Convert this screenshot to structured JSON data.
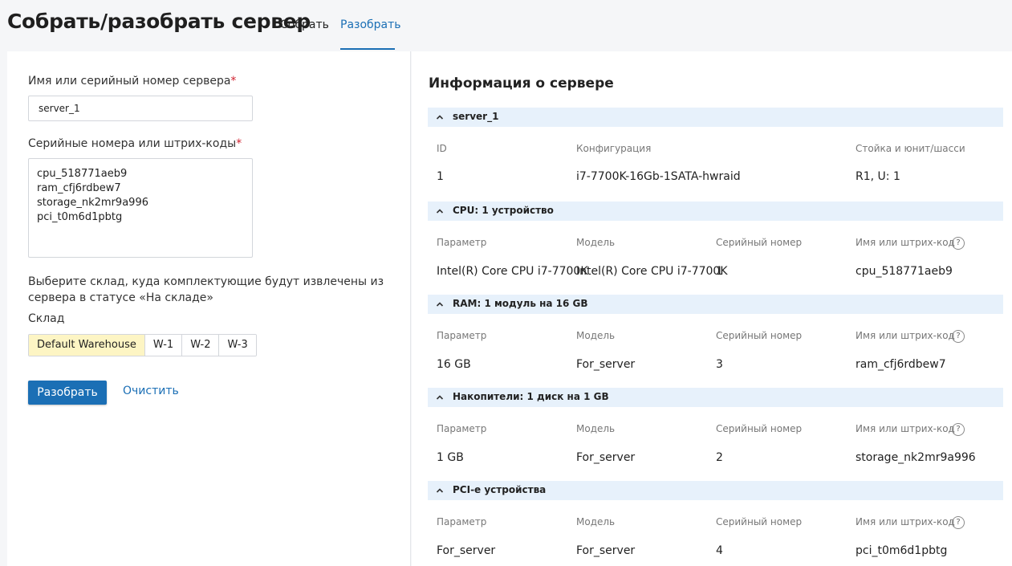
{
  "header": {
    "title": "Собрать/разобрать сервер",
    "tabs": [
      {
        "label": "Собрать"
      },
      {
        "label": "Разобрать"
      }
    ]
  },
  "form": {
    "server_label": "Имя или серийный номер сервера",
    "server_value": "server_1",
    "serials_label": "Серийные номера или штрих-коды",
    "serials_value": "cpu_518771aeb9\nram_cfj6rdbew7\nstorage_nk2mr9a996\npci_t0m6d1pbtg",
    "required_mark": "*",
    "warehouse_desc": "Выберите склад, куда комплектующие будут извлечены из сервера в статусе «На складе»",
    "warehouse_label": "Склад",
    "warehouses": [
      "Default Warehouse",
      "W-1",
      "W-2",
      "W-3"
    ],
    "submit_label": "Разобрать",
    "clear_label": "Очистить"
  },
  "info": {
    "title": "Информация о сервере",
    "help_glyph": "?",
    "server_section": {
      "title": "server_1",
      "headers": [
        "ID",
        "Конфигурация",
        "Стойка и юнит/шасси"
      ],
      "row": [
        "1",
        "i7-7700K-16Gb-1SATA-hwraid",
        "R1, U: 1"
      ]
    },
    "sections": [
      {
        "title": "CPU: 1 устройство",
        "headers": [
          "Параметр",
          "Модель",
          "Серийный номер",
          "Имя или штрих-код"
        ],
        "row": [
          "Intel(R) Core CPU i7-7700K",
          "Intel(R) Core CPU i7-7700K",
          "1",
          "cpu_518771aeb9"
        ]
      },
      {
        "title": "RAM: 1 модуль на 16 GB",
        "headers": [
          "Параметр",
          "Модель",
          "Серийный номер",
          "Имя или штрих-код"
        ],
        "row": [
          "16 GB",
          "For_server",
          "3",
          "ram_cfj6rdbew7"
        ]
      },
      {
        "title": "Накопители: 1 диск на 1 GB",
        "headers": [
          "Параметр",
          "Модель",
          "Серийный номер",
          "Имя или штрих-код"
        ],
        "row": [
          "1 GB",
          "For_server",
          "2",
          "storage_nk2mr9a996"
        ]
      },
      {
        "title": "PCI-e устройства",
        "headers": [
          "Параметр",
          "Модель",
          "Серийный номер",
          "Имя или штрих-код"
        ],
        "row": [
          "For_server",
          "For_server",
          "4",
          "pci_t0m6d1pbtg"
        ]
      }
    ]
  },
  "colors": {
    "accent": "#1b6fb5",
    "section_bg": "#e7f1fb",
    "selected_bg": "#fdf5c4",
    "required": "#d0212f"
  }
}
